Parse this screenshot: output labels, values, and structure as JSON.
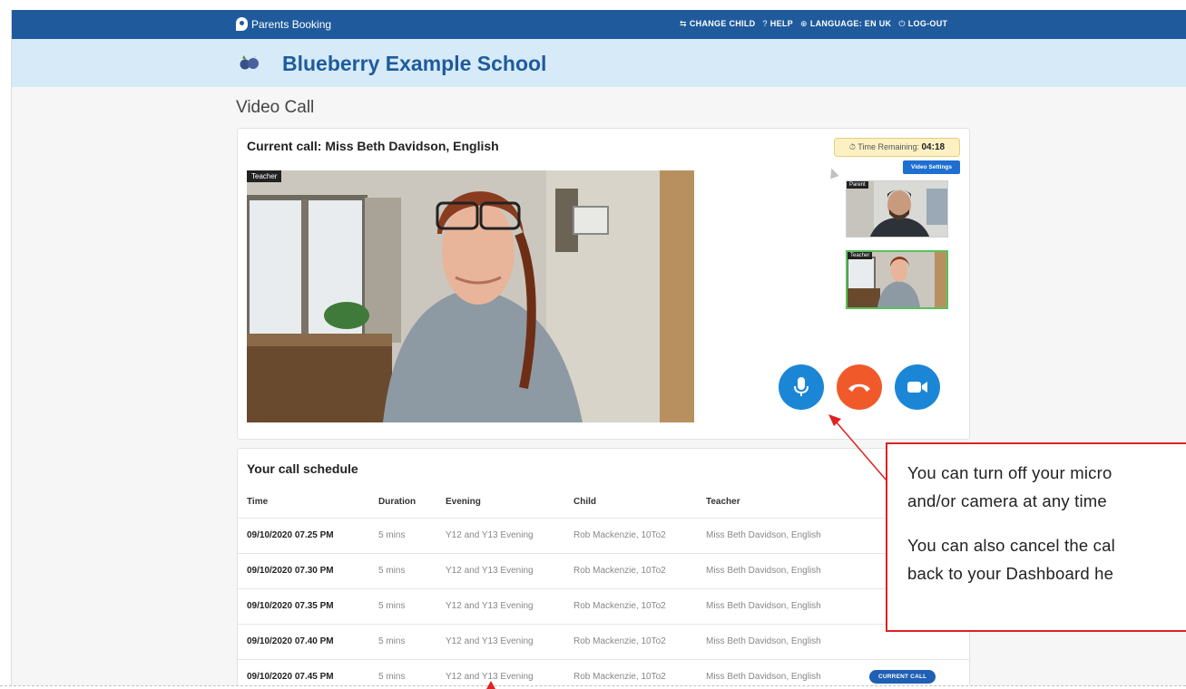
{
  "topbar": {
    "brand": "Parents Booking",
    "nav": [
      {
        "icon": "user-swap-icon",
        "label": "CHANGE CHILD"
      },
      {
        "icon": "help-icon",
        "label": "HELP"
      },
      {
        "icon": "globe-icon",
        "label": "LANGUAGE: EN UK"
      },
      {
        "icon": "power-icon",
        "label": "LOG-OUT"
      }
    ]
  },
  "school": {
    "name": "Blueberry Example School"
  },
  "page": {
    "title": "Video Call"
  },
  "call": {
    "title": "Current call: Miss Beth Davidson, English",
    "timer_label": "Time Remaining:",
    "timer_value": "04:18",
    "video_settings": "Video Settings",
    "main_label": "Teacher",
    "thumb_parent_label": "Parent",
    "thumb_teacher_label": "Teacher",
    "controls": [
      "microphone-icon",
      "hang-up-icon",
      "camera-icon"
    ]
  },
  "schedule": {
    "title": "Your call schedule",
    "columns": [
      "Time",
      "Duration",
      "Evening",
      "Child",
      "Teacher"
    ],
    "rows": [
      {
        "time": "09/10/2020 07.25 PM",
        "duration": "5 mins",
        "evening": "Y12 and Y13 Evening",
        "child": "Rob Mackenzie, 10To2",
        "teacher": "Miss Beth Davidson, English"
      },
      {
        "time": "09/10/2020 07.30 PM",
        "duration": "5 mins",
        "evening": "Y12 and Y13 Evening",
        "child": "Rob Mackenzie, 10To2",
        "teacher": "Miss Beth Davidson, English"
      },
      {
        "time": "09/10/2020 07.35 PM",
        "duration": "5 mins",
        "evening": "Y12 and Y13 Evening",
        "child": "Rob Mackenzie, 10To2",
        "teacher": "Miss Beth Davidson, English"
      },
      {
        "time": "09/10/2020 07.40 PM",
        "duration": "5 mins",
        "evening": "Y12 and Y13 Evening",
        "child": "Rob Mackenzie, 10To2",
        "teacher": "Miss Beth Davidson, English"
      },
      {
        "time": "09/10/2020 07.45 PM",
        "duration": "5 mins",
        "evening": "Y12 and Y13 Evening",
        "child": "Rob Mackenzie, 10To2",
        "teacher": "Miss Beth Davidson, English",
        "badge": "CURRENT CALL"
      }
    ]
  },
  "callout": {
    "lines_1": [
      "You can turn off your micro",
      "and/or camera at any time"
    ],
    "lines_2": [
      "You can also cancel the cal",
      "back to your Dashboard he"
    ]
  },
  "colors": {
    "brand": "#1f5b9c",
    "accent": "#1c86d6",
    "hangup": "#f05a2b",
    "annotation": "#dd2222"
  }
}
